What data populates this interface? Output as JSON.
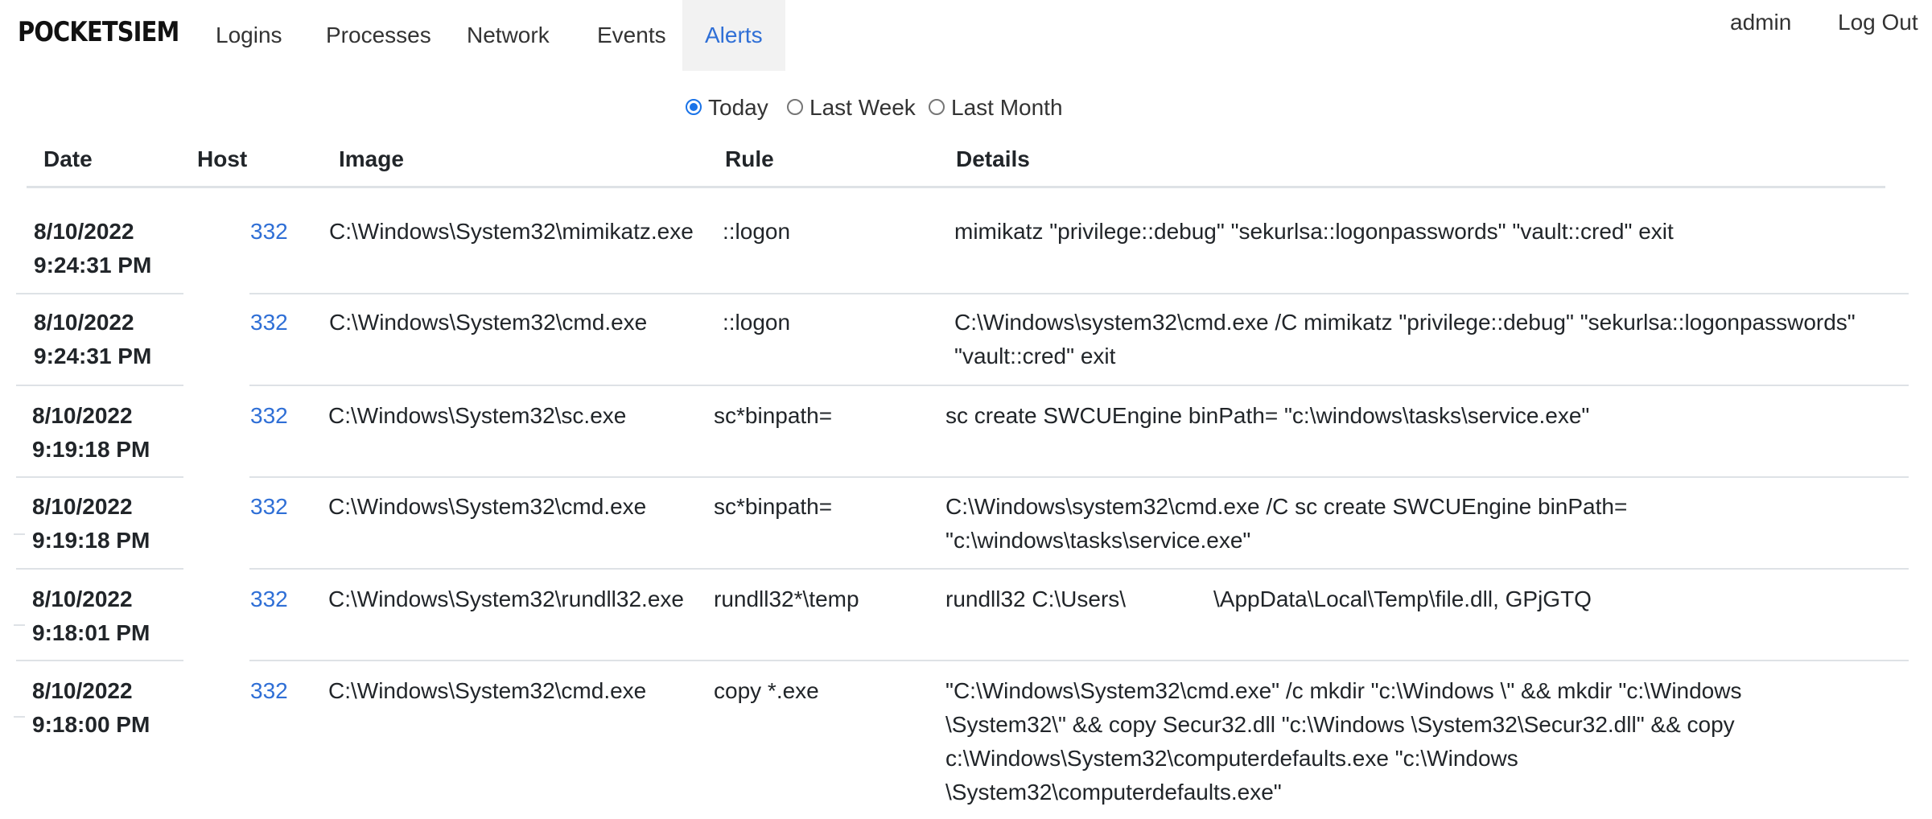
{
  "brand": "POCKETSIEM",
  "nav": {
    "items": [
      "Logins",
      "Processes",
      "Network",
      "Events",
      "Alerts"
    ],
    "active": "Alerts"
  },
  "user": {
    "name": "admin",
    "logout": "Log Out"
  },
  "filter": {
    "options": [
      "Today",
      "Last Week",
      "Last Month"
    ],
    "selected": "Today"
  },
  "table": {
    "headers": [
      "Date",
      "Host",
      "Image",
      "Rule",
      "Details"
    ],
    "rows": [
      {
        "date": "8/10/2022",
        "time": "9:24:31 PM",
        "host": "332",
        "image": "C:\\Windows\\System32\\mimikatz.exe",
        "rule": "::logon",
        "details": "mimikatz \"privilege::debug\" \"sekurlsa::logonpasswords\" \"vault::cred\" exit"
      },
      {
        "date": "8/10/2022",
        "time": "9:24:31 PM",
        "host": "332",
        "image": "C:\\Windows\\System32\\cmd.exe",
        "rule": "::logon",
        "details": "C:\\Windows\\system32\\cmd.exe /C mimikatz \"privilege::debug\" \"sekurlsa::logonpasswords\" \"vault::cred\" exit"
      },
      {
        "date": "8/10/2022",
        "time": "9:19:18 PM",
        "host": "332",
        "image": "C:\\Windows\\System32\\sc.exe",
        "rule": "sc*binpath=",
        "details": "sc create SWCUEngine binPath= \"c:\\windows\\tasks\\service.exe\""
      },
      {
        "date": "8/10/2022",
        "time": "9:19:18 PM",
        "host": "332",
        "image": "C:\\Windows\\System32\\cmd.exe",
        "rule": "sc*binpath=",
        "details": "C:\\Windows\\system32\\cmd.exe /C sc create SWCUEngine binPath= \"c:\\windows\\tasks\\service.exe\""
      },
      {
        "date": "8/10/2022",
        "time": "9:18:01 PM",
        "host": "332",
        "image": "C:\\Windows\\System32\\rundll32.exe",
        "rule": "rundll32*\\temp",
        "details": "rundll32 C:\\Users\\              \\AppData\\Local\\Temp\\file.dll, GPjGTQ"
      },
      {
        "date": "8/10/2022",
        "time": "9:18:00 PM",
        "host": "332",
        "image": "C:\\Windows\\System32\\cmd.exe",
        "rule": "copy *.exe",
        "details": "\"C:\\Windows\\System32\\cmd.exe\" /c mkdir \"c:\\Windows \\\" && mkdir \"c:\\Windows \\System32\\\" && copy Secur32.dll \"c:\\Windows \\System32\\Secur32.dll\" && copy c:\\Windows\\System32\\computerdefaults.exe \"c:\\Windows \\System32\\computerdefaults.exe\""
      }
    ]
  }
}
